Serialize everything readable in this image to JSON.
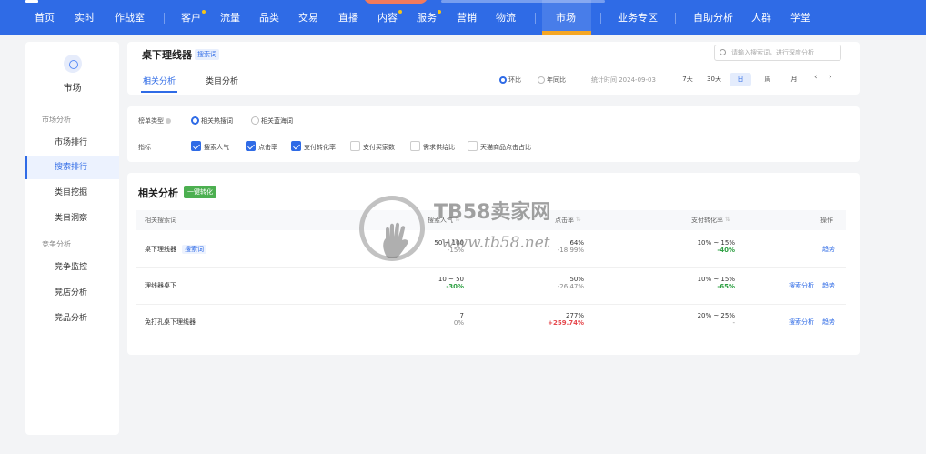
{
  "topnav": {
    "items": [
      {
        "label": "首页"
      },
      {
        "label": "实时"
      },
      {
        "label": "作战室"
      },
      {
        "label": "客户"
      },
      {
        "label": "流量"
      },
      {
        "label": "品类"
      },
      {
        "label": "交易"
      },
      {
        "label": "直播"
      },
      {
        "label": "内容"
      },
      {
        "label": "服务"
      },
      {
        "label": "营销"
      },
      {
        "label": "物流"
      },
      {
        "label": "市场"
      },
      {
        "label": "业务专区"
      },
      {
        "label": "自助分析"
      },
      {
        "label": "人群"
      },
      {
        "label": "学堂"
      }
    ],
    "active": "市场",
    "accent": "#2f6be6"
  },
  "sidebar": {
    "title": "市场",
    "groups": [
      {
        "label": "市场分析",
        "items": [
          {
            "label": "市场排行"
          },
          {
            "label": "搜索排行"
          },
          {
            "label": "类目挖掘"
          },
          {
            "label": "类目洞察"
          }
        ]
      },
      {
        "label": "竞争分析",
        "items": [
          {
            "label": "竞争监控"
          },
          {
            "label": "竞店分析"
          },
          {
            "label": "竞品分析"
          }
        ]
      }
    ],
    "active": "搜索排行"
  },
  "header": {
    "title": "桌下理线器",
    "tag": "搜索词",
    "search_placeholder": "请输入搜索词，进行深度分析",
    "tabs": [
      {
        "label": "相关分析"
      },
      {
        "label": "类目分析"
      }
    ],
    "compare": [
      {
        "label": "环比"
      },
      {
        "label": "年同比"
      }
    ],
    "stat_time": "统计时间 2024-09-03",
    "periods": [
      {
        "label": "7天"
      },
      {
        "label": "30天"
      },
      {
        "label": "日"
      },
      {
        "label": "周"
      },
      {
        "label": "月"
      }
    ],
    "prev": "‹",
    "next": "›"
  },
  "filters": {
    "list_type_label": "榜单类型",
    "list_types": [
      {
        "label": "相关热搜词"
      },
      {
        "label": "相关蓝海词"
      }
    ],
    "metrics_label": "指标",
    "metrics": [
      {
        "label": "搜索人气",
        "checked": true
      },
      {
        "label": "点击率",
        "checked": true
      },
      {
        "label": "支付转化率",
        "checked": true
      },
      {
        "label": "支付买家数",
        "checked": false
      },
      {
        "label": "需求供给比",
        "checked": false
      },
      {
        "label": "天猫商品点击占比",
        "checked": false
      }
    ]
  },
  "table": {
    "title": "相关分析",
    "convert_button": "一键转化",
    "columns": [
      "相关搜索词",
      "搜索人气",
      "点击率",
      "支付转化率",
      "操作"
    ],
    "rows": [
      {
        "keyword": "桌下理线器",
        "tag": "搜索词",
        "pop": "50 ~ 100",
        "pop_chg": "-15%",
        "pop_chg_type": "gray",
        "ctr": "64%",
        "ctr_chg": "-18.99%",
        "ctr_chg_type": "gray",
        "cvr": "10% ~ 15%",
        "cvr_chg": "-40%",
        "cvr_chg_type": "green",
        "actions": [
          "趋势"
        ]
      },
      {
        "keyword": "理线器桌下",
        "tag": "",
        "pop": "10 ~ 50",
        "pop_chg": "-30%",
        "pop_chg_type": "green",
        "ctr": "50%",
        "ctr_chg": "-26.47%",
        "ctr_chg_type": "gray",
        "cvr": "10% ~ 15%",
        "cvr_chg": "-65%",
        "cvr_chg_type": "green",
        "actions": [
          "搜索分析",
          "趋势"
        ]
      },
      {
        "keyword": "免打孔桌下理线器",
        "tag": "",
        "pop": "7",
        "pop_chg": "0%",
        "pop_chg_type": "gray",
        "ctr": "277%",
        "ctr_chg": "+259.74%",
        "ctr_chg_type": "red",
        "cvr": "20% ~ 25%",
        "cvr_chg": "-",
        "cvr_chg_type": "gray",
        "actions": [
          "搜索分析",
          "趋势"
        ]
      }
    ]
  },
  "watermark": {
    "title": "TB58卖家网",
    "url": "www.tb58.net"
  }
}
